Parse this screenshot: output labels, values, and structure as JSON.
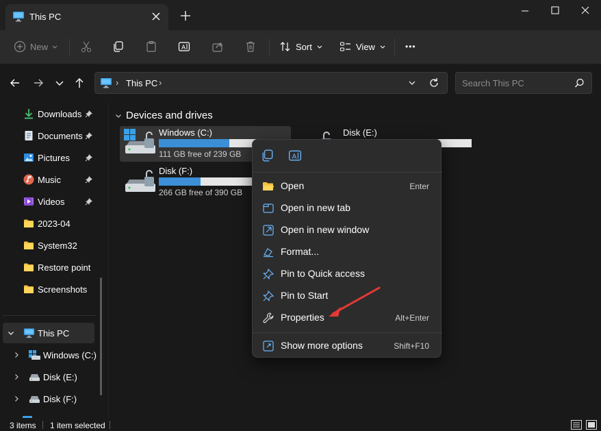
{
  "window": {
    "tab_title": "This PC",
    "new_tab_symbol": "+"
  },
  "toolbar": {
    "new_label": "New",
    "sort_label": "Sort",
    "view_label": "View",
    "more_label": "•••"
  },
  "address": {
    "location": "This PC",
    "separator": "›",
    "search_placeholder": "Search This PC"
  },
  "sidebar": {
    "quick": [
      {
        "label": "Downloads",
        "icon": "download-icon",
        "pinned": true
      },
      {
        "label": "Documents",
        "icon": "documents-icon",
        "pinned": true
      },
      {
        "label": "Pictures",
        "icon": "pictures-icon",
        "pinned": true
      },
      {
        "label": "Music",
        "icon": "music-icon",
        "pinned": true
      },
      {
        "label": "Videos",
        "icon": "videos-icon",
        "pinned": true
      },
      {
        "label": "2023-04",
        "icon": "folder-icon",
        "pinned": false
      },
      {
        "label": "System32",
        "icon": "folder-icon",
        "pinned": false
      },
      {
        "label": "Restore point",
        "icon": "folder-icon",
        "pinned": false
      },
      {
        "label": "Screenshots",
        "icon": "folder-icon",
        "pinned": false
      }
    ],
    "this_pc": {
      "label": "This PC"
    },
    "drives": [
      {
        "label": "Windows (C:)"
      },
      {
        "label": "Disk (E:)"
      },
      {
        "label": "Disk (F:)"
      }
    ]
  },
  "main": {
    "group_title": "Devices and drives",
    "drives": [
      {
        "name": "Windows (C:)",
        "free": "111 GB free of 239 GB",
        "used_fraction": 0.535
      },
      {
        "name": "Disk (E:)",
        "free": "",
        "used_fraction": 0.0
      },
      {
        "name": "Disk (F:)",
        "free": "266 GB free of 390 GB",
        "used_fraction": 0.318
      }
    ]
  },
  "context_menu": {
    "items": [
      {
        "label": "Open",
        "shortcut": "Enter",
        "icon": "folder-open-icon"
      },
      {
        "label": "Open in new tab",
        "shortcut": "",
        "icon": "new-tab-icon"
      },
      {
        "label": "Open in new window",
        "shortcut": "",
        "icon": "new-window-icon"
      },
      {
        "label": "Format...",
        "shortcut": "",
        "icon": "format-icon"
      },
      {
        "label": "Pin to Quick access",
        "shortcut": "",
        "icon": "pin-icon"
      },
      {
        "label": "Pin to Start",
        "shortcut": "",
        "icon": "pin-icon"
      },
      {
        "label": "Properties",
        "shortcut": "Alt+Enter",
        "icon": "wrench-icon"
      }
    ],
    "more": {
      "label": "Show more options",
      "shortcut": "Shift+F10",
      "icon": "more-options-icon"
    }
  },
  "status": {
    "item_count": "3 items",
    "selection": "1 item selected"
  },
  "colors": {
    "accent": "#3c8fd6",
    "folder": "#f5c342",
    "annotation_arrow": "#e53935"
  }
}
